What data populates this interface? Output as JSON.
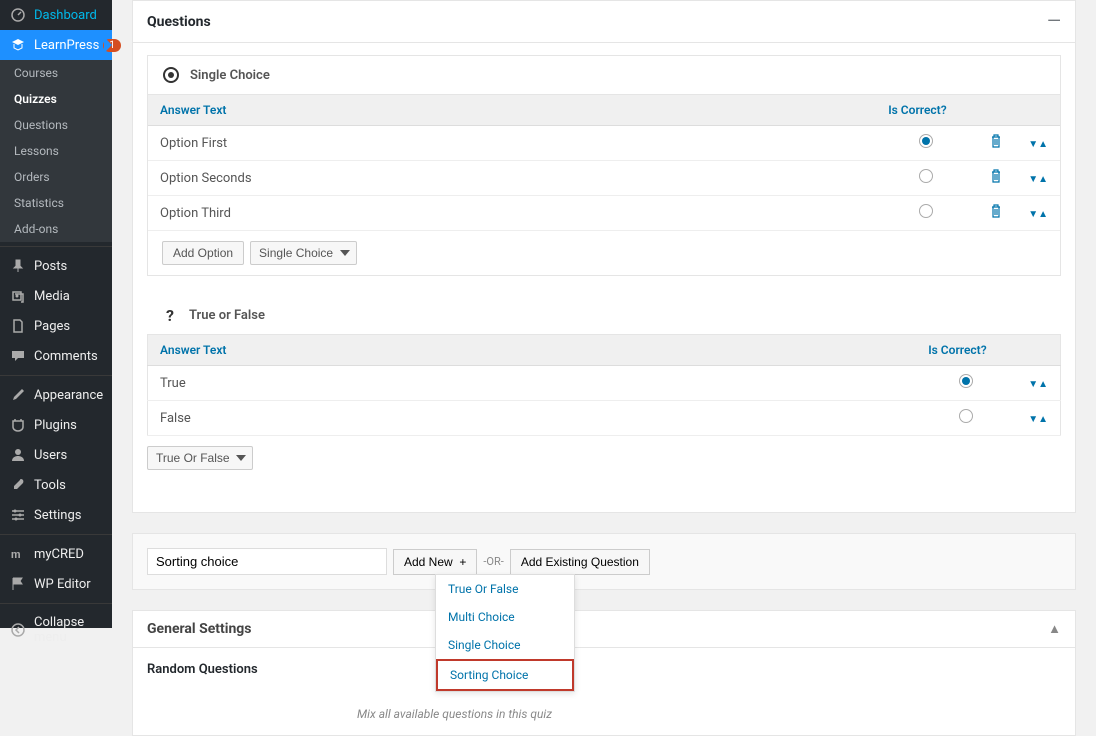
{
  "sidebar": {
    "dashboard": "Dashboard",
    "learnpress": "LearnPress",
    "learnpress_badge": "1",
    "sub": {
      "courses": "Courses",
      "quizzes": "Quizzes",
      "questions": "Questions",
      "lessons": "Lessons",
      "orders": "Orders",
      "statistics": "Statistics",
      "addons": "Add-ons"
    },
    "posts": "Posts",
    "media": "Media",
    "pages": "Pages",
    "comments": "Comments",
    "appearance": "Appearance",
    "plugins": "Plugins",
    "users": "Users",
    "tools": "Tools",
    "settings": "Settings",
    "mycred": "myCRED",
    "wpeditor": "WP Editor",
    "collapse": "Collapse menu"
  },
  "panel": {
    "title": "Questions"
  },
  "q1": {
    "title": "Single Choice",
    "col_answer": "Answer Text",
    "col_correct": "Is Correct?",
    "rows": {
      "r0": "Option First",
      "r1": "Option Seconds",
      "r2": "Option Third"
    },
    "add_option": "Add Option",
    "type_select": "Single Choice"
  },
  "q2": {
    "title": "True or False",
    "col_answer": "Answer Text",
    "col_correct": "Is Correct?",
    "rows": {
      "r0": "True",
      "r1": "False"
    },
    "type_select": "True Or False"
  },
  "addq": {
    "input_value": "Sorting choice",
    "add_new": "Add New",
    "or": "-OR-",
    "add_existing": "Add Existing Question",
    "menu": {
      "m0": "True Or False",
      "m1": "Multi Choice",
      "m2": "Single Choice",
      "m3": "Sorting Choice"
    }
  },
  "general": {
    "title": "General Settings",
    "random_label": "Random Questions",
    "random_desc": "Mix all available questions in this quiz"
  }
}
